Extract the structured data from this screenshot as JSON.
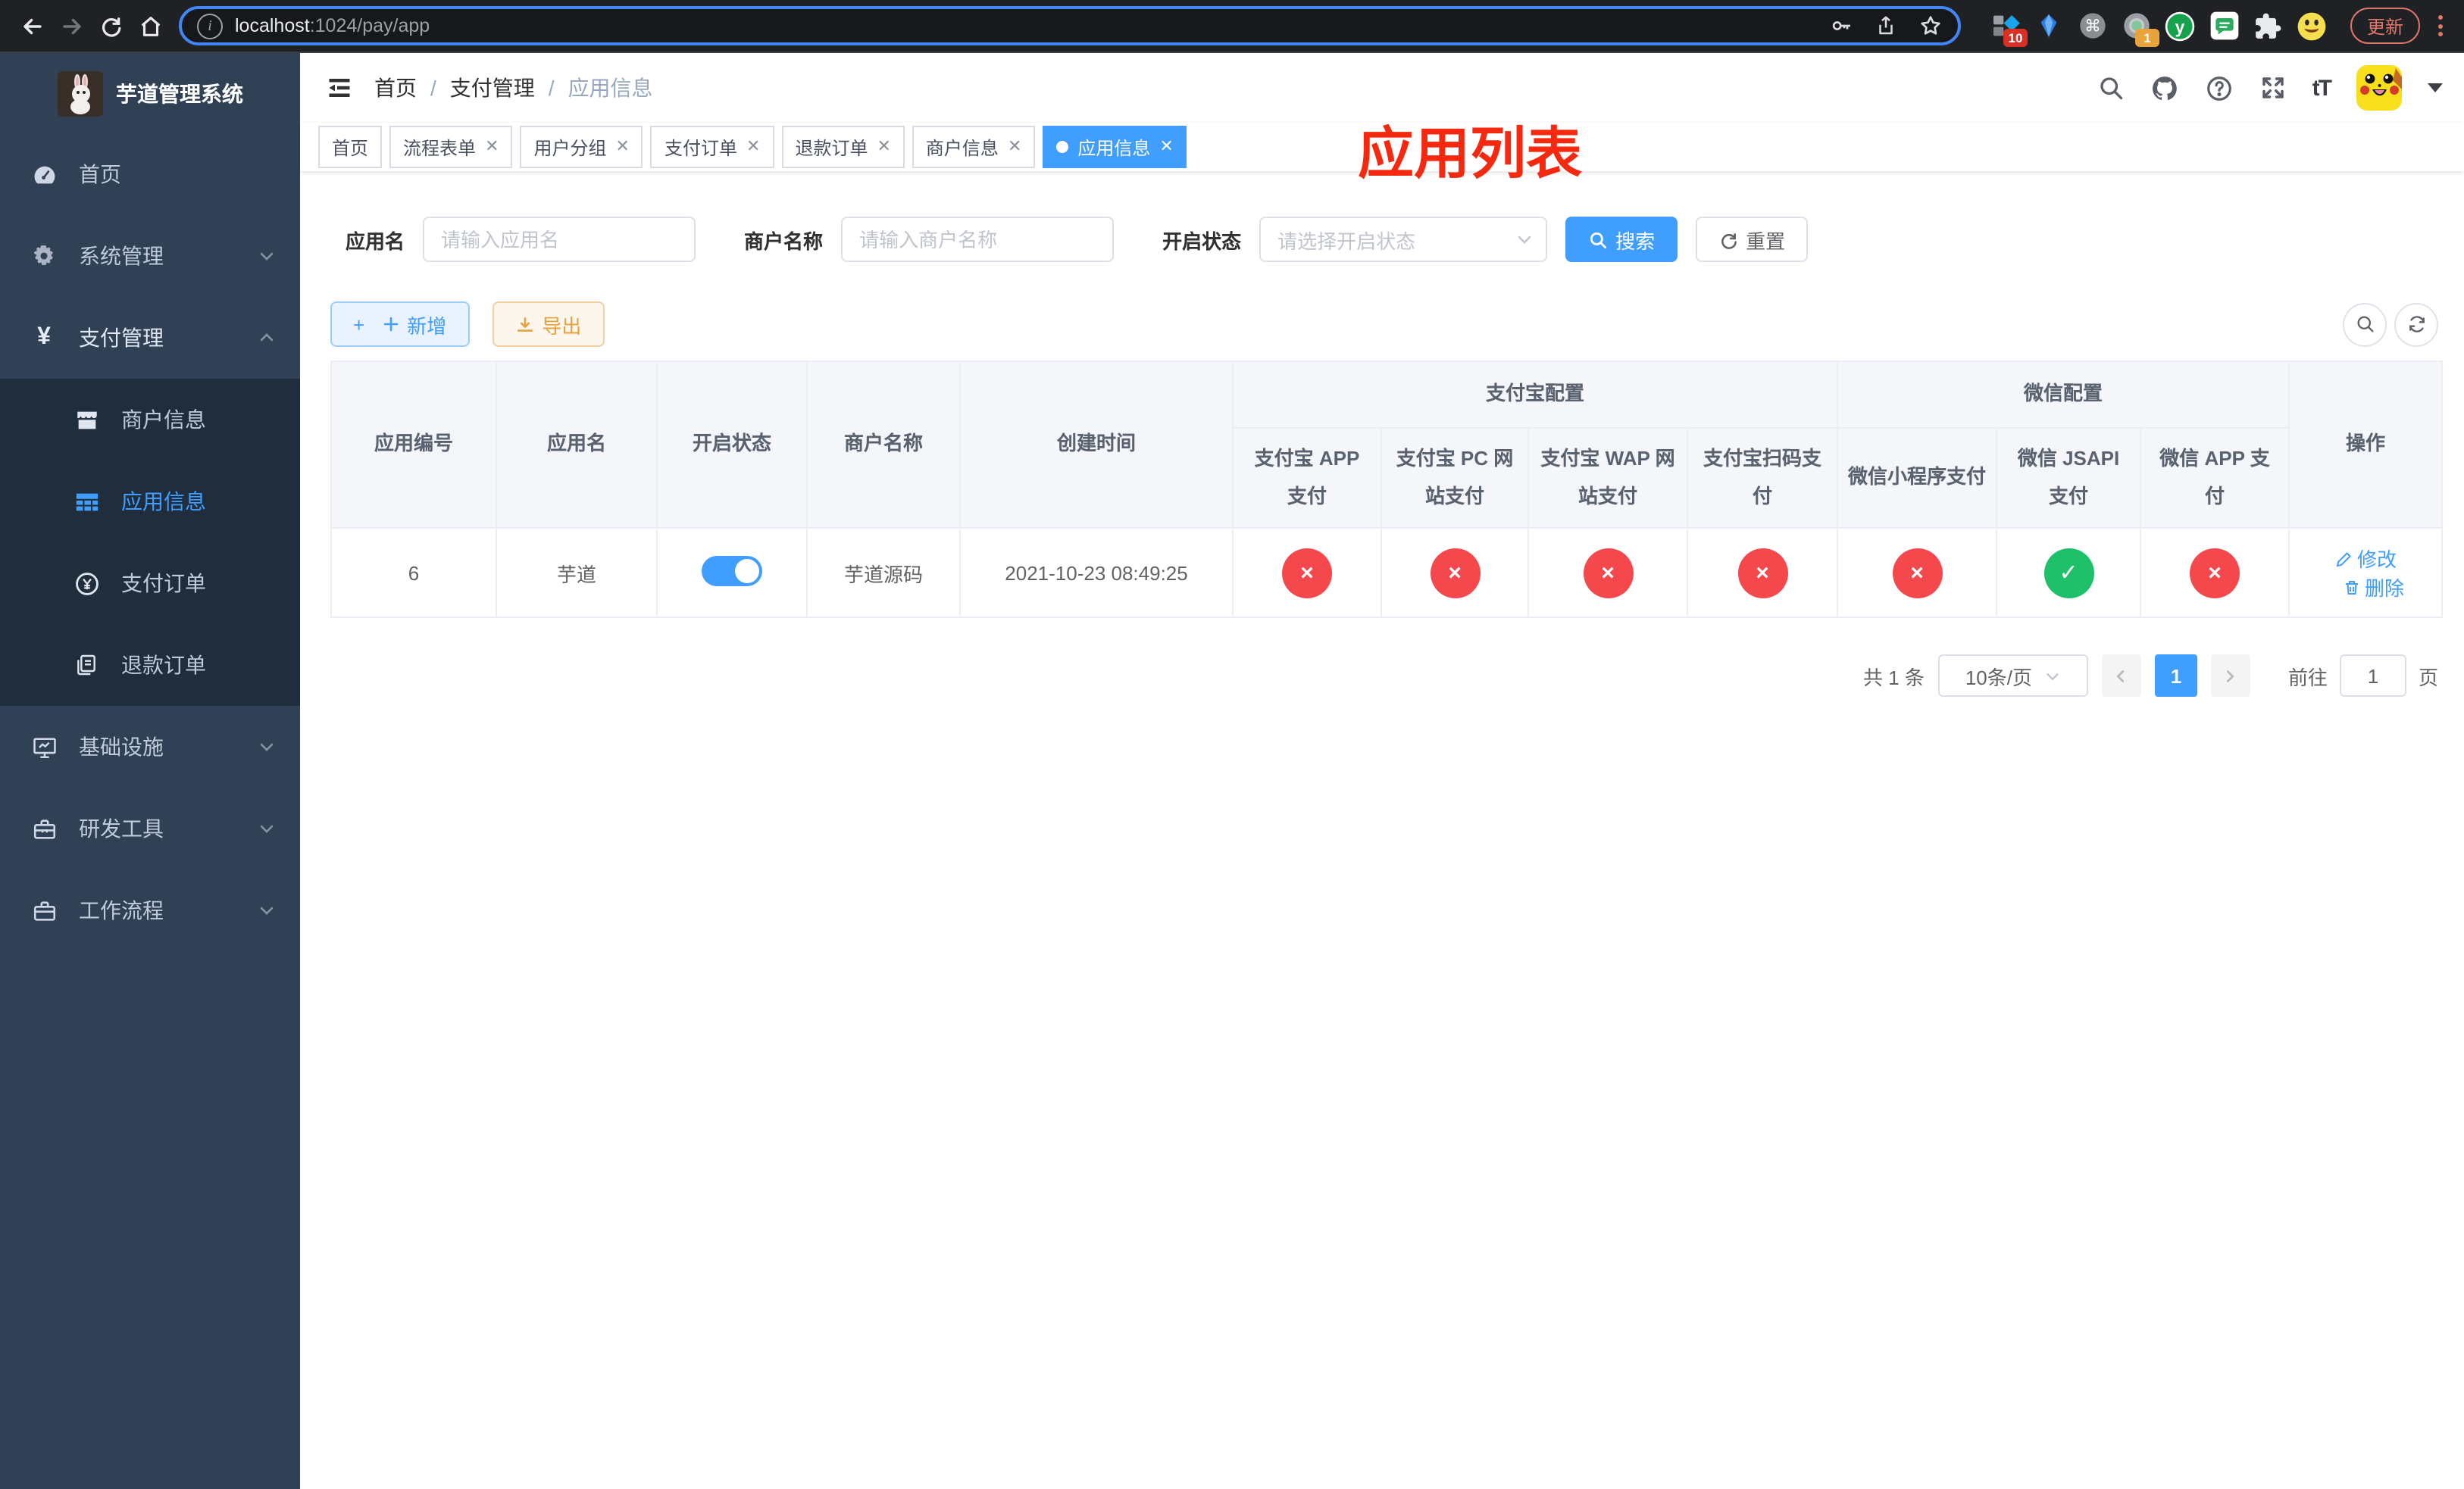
{
  "colors": {
    "primary": "#409eff",
    "danger": "#f5484d",
    "success": "#1fc06a",
    "warning": "#e6a23c",
    "annotation": "#f5290f"
  },
  "icons": {
    "yen": "¥",
    "cmd": "⌘",
    "letter_y": "y",
    "question": "?",
    "plus": "+",
    "check": "✓",
    "cross": "×",
    "font_size": "tT"
  },
  "browser": {
    "url_host": "localhost",
    "url_path": ":1024/pay/app",
    "update_label": "更新",
    "ext_badges": [
      "10",
      "1"
    ]
  },
  "sidebar": {
    "title": "芋道管理系统",
    "menu": [
      {
        "label": "首页"
      },
      {
        "label": "系统管理"
      },
      {
        "label": "支付管理"
      },
      {
        "label": "商户信息"
      },
      {
        "label": "应用信息"
      },
      {
        "label": "支付订单"
      },
      {
        "label": "退款订单"
      },
      {
        "label": "基础设施"
      },
      {
        "label": "研发工具"
      },
      {
        "label": "工作流程"
      }
    ]
  },
  "breadcrumb": {
    "items": [
      "首页",
      "支付管理",
      "应用信息"
    ],
    "separator": "/"
  },
  "annotation": {
    "text": "应用列表"
  },
  "tabs": [
    {
      "label": "首页",
      "closable": false,
      "active": false
    },
    {
      "label": "流程表单",
      "closable": true,
      "active": false
    },
    {
      "label": "用户分组",
      "closable": true,
      "active": false
    },
    {
      "label": "支付订单",
      "closable": true,
      "active": false
    },
    {
      "label": "退款订单",
      "closable": true,
      "active": false
    },
    {
      "label": "商户信息",
      "closable": true,
      "active": false
    },
    {
      "label": "应用信息",
      "closable": true,
      "active": true
    }
  ],
  "filters": {
    "app_name": {
      "label": "应用名",
      "placeholder": "请输入应用名"
    },
    "merchant": {
      "label": "商户名称",
      "placeholder": "请输入商户名称"
    },
    "status": {
      "label": "开启状态",
      "placeholder": "请选择开启状态"
    },
    "search_label": "搜索",
    "reset_label": "重置"
  },
  "toolbar": {
    "add_label": "新增",
    "export_label": "导出"
  },
  "table": {
    "columns": [
      "应用编号",
      "应用名",
      "开启状态",
      "商户名称",
      "创建时间"
    ],
    "groups": {
      "alipay": "支付宝配置",
      "wechat": "微信配置"
    },
    "sub_columns": [
      "支付宝 APP 支付",
      "支付宝 PC 网站支付",
      "支付宝 WAP 网站支付",
      "支付宝扫码支付",
      "微信小程序支付",
      "微信 JSAPI 支付",
      "微信 APP 支付"
    ],
    "ops_header": "操作",
    "row": {
      "id": "6",
      "name": "芋道",
      "enabled": true,
      "merchant": "芋道源码",
      "created": "2021-10-23 08:49:25",
      "statuses": [
        false,
        false,
        false,
        false,
        false,
        true,
        false
      ],
      "ops": [
        "修改",
        "删除"
      ]
    }
  },
  "pagination": {
    "total": "共 1 条",
    "page_size": "10条/页",
    "current": "1",
    "goto_label": "前往",
    "goto_value": "1",
    "unit": "页"
  }
}
